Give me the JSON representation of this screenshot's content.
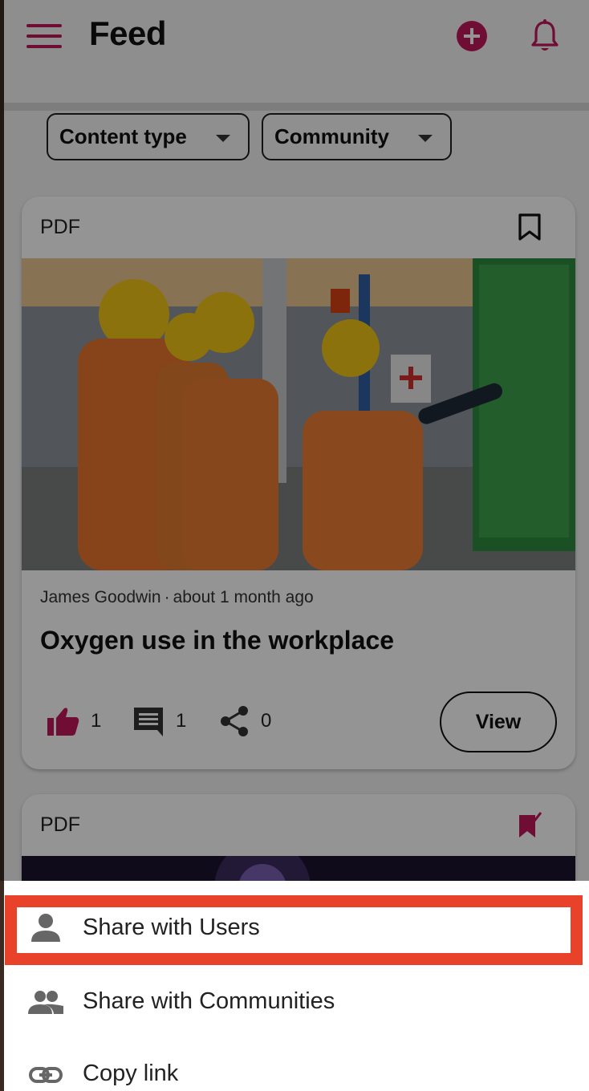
{
  "header": {
    "title": "Feed",
    "menu_icon": "hamburger-menu-icon",
    "add_icon": "plus-circle-icon",
    "notification_icon": "bell-icon",
    "accent_color": "#c2185b"
  },
  "filters": [
    {
      "label": "Content type"
    },
    {
      "label": "Community"
    }
  ],
  "cards": [
    {
      "type": "PDF",
      "bookmark_icon": "bookmark-outline-icon",
      "author": "James Goodwin",
      "separator": "·",
      "time": "about 1 month ago",
      "title": "Oxygen use in the workplace",
      "likes": "1",
      "comments": "1",
      "shares": "0",
      "view_label": "View"
    },
    {
      "type": "PDF",
      "bookmark_icon": "bookmark-checked-icon"
    }
  ],
  "share_sheet": {
    "items": [
      {
        "label": "Share with Users",
        "icon": "person-icon"
      },
      {
        "label": "Share with Communities",
        "icon": "people-icon"
      },
      {
        "label": "Copy link",
        "icon": "link-icon"
      }
    ]
  },
  "highlight_color": "#e8432a"
}
